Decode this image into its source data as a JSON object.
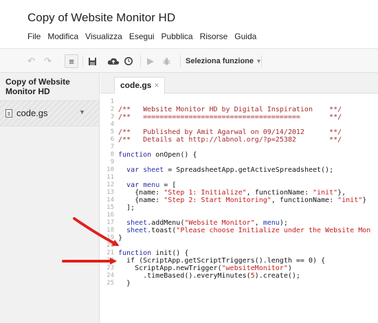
{
  "app": {
    "title": "Copy of Website Monitor HD"
  },
  "menu": [
    "File",
    "Modifica",
    "Visualizza",
    "Esegui",
    "Pubblica",
    "Risorse",
    "Guida"
  ],
  "toolbar": {
    "undo_icon": "undo-icon",
    "redo_icon": "redo-icon",
    "indent_icon": "indent-icon",
    "save_icon": "save-icon",
    "deploy_icon": "cloud-icon",
    "triggers_icon": "clock-icon",
    "run_icon": "play-icon",
    "debug_icon": "bug-icon",
    "function_select": "Seleziona funzione"
  },
  "sidebar": {
    "project_name": "Copy of Website Monitor HD",
    "files": [
      {
        "name": "code.gs"
      }
    ]
  },
  "tabs": [
    {
      "label": "code.gs",
      "close": "×"
    }
  ],
  "editor": {
    "line_numbers": [
      "1",
      "2",
      "3",
      "4",
      "5",
      "6",
      "7",
      "8",
      "9",
      "10",
      "11",
      "12",
      "13",
      "14",
      "15",
      "16",
      "17",
      "18",
      "19",
      "20",
      "21",
      "22",
      "23",
      "24",
      "25"
    ],
    "lines": [
      [],
      [
        {
          "t": "/**   Website Monitor HD by Digital Inspiration    **/",
          "c": "c"
        }
      ],
      [
        {
          "t": "/**   ======================================       **/",
          "c": "c"
        }
      ],
      [],
      [
        {
          "t": "/**   Published by Amit Agarwal on 09/14/2012      **/",
          "c": "c"
        }
      ],
      [
        {
          "t": "/**   Details at http://labnol.org/?p=25382        **/",
          "c": "c"
        }
      ],
      [],
      [
        {
          "t": "function",
          "c": "k"
        },
        {
          "t": " onOpen() {",
          "c": "t"
        }
      ],
      [],
      [
        {
          "t": "  ",
          "c": "t"
        },
        {
          "t": "var",
          "c": "k"
        },
        {
          "t": " ",
          "c": "t"
        },
        {
          "t": "sheet",
          "c": "v"
        },
        {
          "t": " = SpreadsheetApp.getActiveSpreadsheet();",
          "c": "t"
        }
      ],
      [],
      [
        {
          "t": "  ",
          "c": "t"
        },
        {
          "t": "var",
          "c": "k"
        },
        {
          "t": " ",
          "c": "t"
        },
        {
          "t": "menu",
          "c": "v"
        },
        {
          "t": " = [",
          "c": "t"
        }
      ],
      [
        {
          "t": "    {name: ",
          "c": "t"
        },
        {
          "t": "\"Step 1: Initialize\"",
          "c": "s"
        },
        {
          "t": ", functionName: ",
          "c": "t"
        },
        {
          "t": "\"init\"",
          "c": "s"
        },
        {
          "t": "},",
          "c": "t"
        }
      ],
      [
        {
          "t": "    {name: ",
          "c": "t"
        },
        {
          "t": "\"Step 2: Start Monitoring\"",
          "c": "s"
        },
        {
          "t": ", functionName: ",
          "c": "t"
        },
        {
          "t": "\"init\"",
          "c": "s"
        },
        {
          "t": "}",
          "c": "t"
        }
      ],
      [
        {
          "t": "  ];",
          "c": "t"
        }
      ],
      [],
      [
        {
          "t": "  ",
          "c": "t"
        },
        {
          "t": "sheet",
          "c": "v"
        },
        {
          "t": ".addMenu(",
          "c": "t"
        },
        {
          "t": "\"Website Monitor\"",
          "c": "s"
        },
        {
          "t": ", ",
          "c": "t"
        },
        {
          "t": "menu",
          "c": "v"
        },
        {
          "t": ");",
          "c": "t"
        }
      ],
      [
        {
          "t": "  ",
          "c": "t"
        },
        {
          "t": "sheet",
          "c": "v"
        },
        {
          "t": ".toast(",
          "c": "t"
        },
        {
          "t": "\"Please choose Initialize under the Website Mon",
          "c": "s"
        }
      ],
      [
        {
          "t": "}",
          "c": "t"
        }
      ],
      [],
      [
        {
          "t": "function",
          "c": "k"
        },
        {
          "t": " init() {",
          "c": "t"
        }
      ],
      [
        {
          "t": "  if (ScriptApp.getScriptTriggers().length == 0) {",
          "c": "t"
        }
      ],
      [
        {
          "t": "    ScriptApp.newTrigger(",
          "c": "t"
        },
        {
          "t": "\"websiteMonitor\"",
          "c": "s"
        },
        {
          "t": ")",
          "c": "t"
        }
      ],
      [
        {
          "t": "      .timeBased().everyMinutes(",
          "c": "t"
        },
        {
          "t": "5",
          "c": "s"
        },
        {
          "t": ").create();",
          "c": "t"
        }
      ],
      [
        {
          "t": "  }",
          "c": "t"
        }
      ]
    ]
  }
}
